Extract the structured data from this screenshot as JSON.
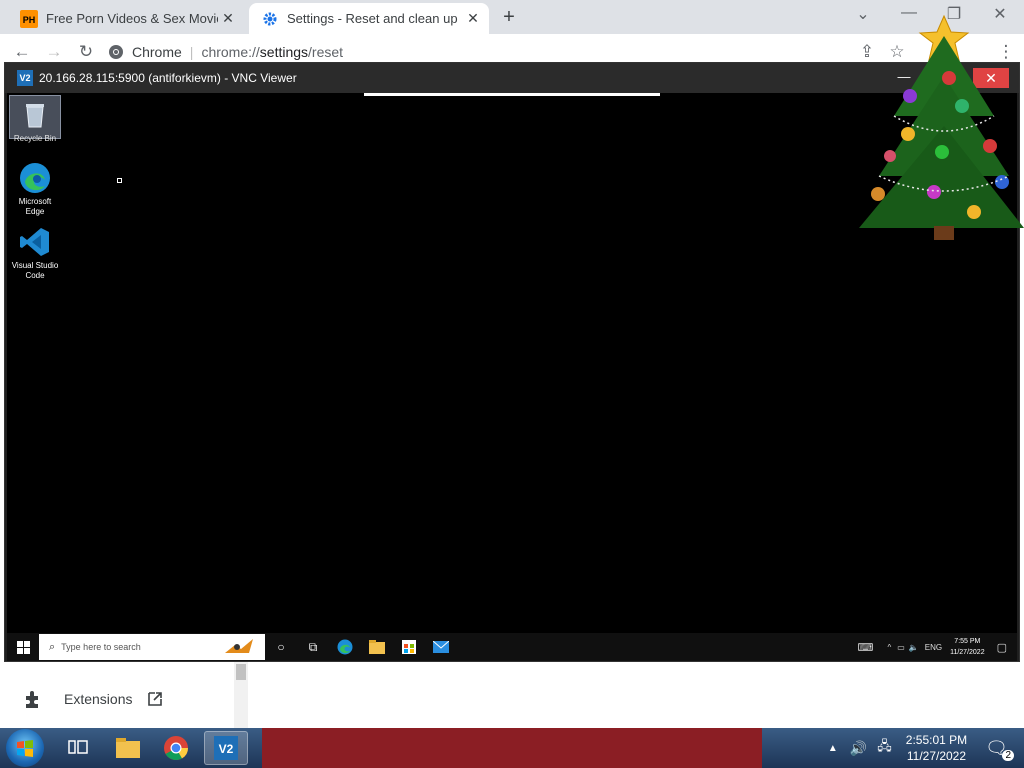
{
  "browser": {
    "tabs": [
      {
        "title": "Free Porn Videos & Sex Movies -",
        "favicon": "PH"
      },
      {
        "title": "Settings - Reset and clean up",
        "favicon": "gear-icon"
      }
    ],
    "omnibox": {
      "site": "Chrome",
      "url_prefix": "chrome://",
      "url_bold": "settings",
      "url_suffix": "/reset"
    }
  },
  "vnc": {
    "logo": "V2",
    "title": "20.166.28.115:5900 (antiforkievm) - VNC Viewer",
    "desktop_icons": [
      {
        "label": "Recycle Bin"
      },
      {
        "label": "Microsoft Edge"
      },
      {
        "label": "Visual Studio Code"
      }
    ],
    "taskbar": {
      "search_placeholder": "Type here to search",
      "lang": "ENG",
      "time": "7:55 PM",
      "date": "11/27/2022"
    }
  },
  "settings_page": {
    "extensions_label": "Extensions"
  },
  "host_taskbar": {
    "time": "2:55:01 PM",
    "date": "11/27/2022",
    "notification_count": "2"
  }
}
